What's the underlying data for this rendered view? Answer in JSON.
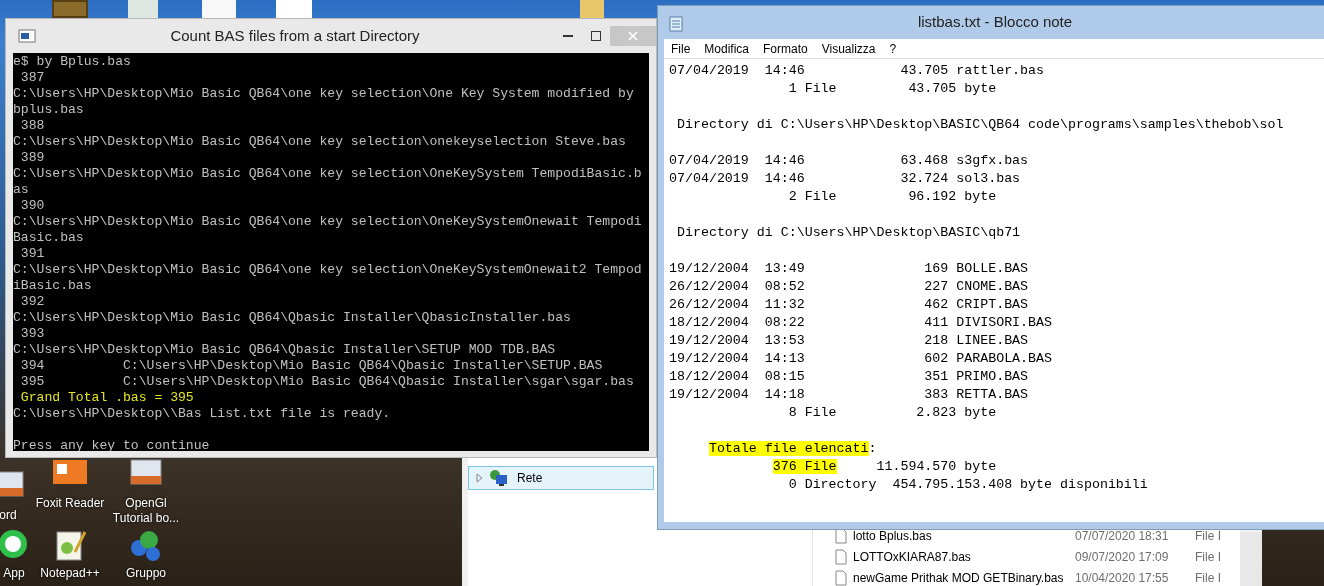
{
  "desktop_icons": [
    {
      "label": "ord",
      "kind": "doc"
    },
    {
      "label": "Foxit Reader",
      "kind": "pdf"
    },
    {
      "label": "OpenGl Tutorial bo...",
      "kind": "doc"
    },
    {
      "label": "App",
      "kind": "chat"
    },
    {
      "label": "Notepad++",
      "kind": "notepad"
    },
    {
      "label": "Gruppo",
      "kind": "group"
    }
  ],
  "console": {
    "title": "Count BAS files from a start Directory",
    "lines": [
      {
        "text": "e$ by Bplus.bas",
        "highlighted": false,
        "gap_before": false
      },
      {
        "text": " 387",
        "highlighted": false,
        "gap_before": false
      },
      {
        "text": "C:\\Users\\HP\\Desktop\\Mio Basic QB64\\one key selection\\One Key System modified by",
        "highlighted": false,
        "gap_before": false
      },
      {
        "text": "bplus.bas",
        "highlighted": false,
        "gap_before": false
      },
      {
        "text": " 388",
        "highlighted": false,
        "gap_before": false
      },
      {
        "text": "C:\\Users\\HP\\Desktop\\Mio Basic QB64\\one key selection\\onekeyselection Steve.bas",
        "highlighted": false,
        "gap_before": false
      },
      {
        "text": " 389",
        "highlighted": false,
        "gap_before": false
      },
      {
        "text": "C:\\Users\\HP\\Desktop\\Mio Basic QB64\\one key selection\\OneKeySystem TempodiBasic.b",
        "highlighted": false,
        "gap_before": false
      },
      {
        "text": "as",
        "highlighted": false,
        "gap_before": false
      },
      {
        "text": " 390",
        "highlighted": false,
        "gap_before": false
      },
      {
        "text": "C:\\Users\\HP\\Desktop\\Mio Basic QB64\\one key selection\\OneKeySystemOnewait Tempodi",
        "highlighted": false,
        "gap_before": false
      },
      {
        "text": "Basic.bas",
        "highlighted": false,
        "gap_before": false
      },
      {
        "text": " 391",
        "highlighted": false,
        "gap_before": false
      },
      {
        "text": "C:\\Users\\HP\\Desktop\\Mio Basic QB64\\one key selection\\OneKeySystemOnewait2 Tempod",
        "highlighted": false,
        "gap_before": false
      },
      {
        "text": "iBasic.bas",
        "highlighted": false,
        "gap_before": false
      },
      {
        "text": " 392",
        "highlighted": false,
        "gap_before": false
      },
      {
        "text": "C:\\Users\\HP\\Desktop\\Mio Basic QB64\\Qbasic Installer\\QbasicInstaller.bas",
        "highlighted": false,
        "gap_before": false
      },
      {
        "text": " 393",
        "highlighted": false,
        "gap_before": false
      },
      {
        "text": "C:\\Users\\HP\\Desktop\\Mio Basic QB64\\Qbasic Installer\\SETUP MOD TDB.BAS",
        "highlighted": false,
        "gap_before": false
      },
      {
        "text": " 394          C:\\Users\\HP\\Desktop\\Mio Basic QB64\\Qbasic Installer\\SETUP.BAS",
        "highlighted": false,
        "gap_before": false
      },
      {
        "text": " 395          C:\\Users\\HP\\Desktop\\Mio Basic QB64\\Qbasic Installer\\sgar\\sgar.bas",
        "highlighted": false,
        "gap_before": false
      },
      {
        "text": " Grand Total .bas = 395",
        "highlighted": true,
        "gap_before": false
      },
      {
        "text": "C:\\Users\\HP\\Desktop\\\\Bas List.txt file is ready.",
        "highlighted": false,
        "gap_before": false
      },
      {
        "text": "Press any key to continue",
        "highlighted": false,
        "gap_before": true
      }
    ]
  },
  "explorer": {
    "nav_items": [
      {
        "label": "Rete",
        "expanded": false,
        "selected": true
      }
    ],
    "files": [
      {
        "name": "lotto Bplus.bas",
        "modified": "07/07/2020 18:31",
        "type": "File I"
      },
      {
        "name": "LOTTOxKIARA87.bas",
        "modified": "09/07/2020 17:09",
        "type": "File I"
      },
      {
        "name": "newGame Prithak MOD GETBinary.bas",
        "modified": "10/04/2020 17:55",
        "type": "File I"
      }
    ]
  },
  "notepad": {
    "title": "listbas.txt - Blocco note",
    "menu": [
      "File",
      "Modifica",
      "Formato",
      "Visualizza",
      "?"
    ],
    "lines": [
      {
        "gap_before": false,
        "segments": [
          {
            "text": "07/04/2019  14:46            43.705 rattler.bas",
            "highlighted": false
          }
        ]
      },
      {
        "gap_before": false,
        "segments": [
          {
            "text": "               1 File         43.705 byte",
            "highlighted": false
          }
        ]
      },
      {
        "gap_before": true,
        "segments": [
          {
            "text": " Directory di C:\\Users\\HP\\Desktop\\BASIC\\QB64 code\\programs\\samples\\thebob\\sol",
            "highlighted": false
          }
        ]
      },
      {
        "gap_before": true,
        "segments": [
          {
            "text": "07/04/2019  14:46            63.468 s3gfx.bas",
            "highlighted": false
          }
        ]
      },
      {
        "gap_before": false,
        "segments": [
          {
            "text": "07/04/2019  14:46            32.724 sol3.bas",
            "highlighted": false
          }
        ]
      },
      {
        "gap_before": false,
        "segments": [
          {
            "text": "               2 File         96.192 byte",
            "highlighted": false
          }
        ]
      },
      {
        "gap_before": true,
        "segments": [
          {
            "text": " Directory di C:\\Users\\HP\\Desktop\\BASIC\\qb71",
            "highlighted": false
          }
        ]
      },
      {
        "gap_before": true,
        "segments": [
          {
            "text": "19/12/2004  13:49               169 BOLLE.BAS",
            "highlighted": false
          }
        ]
      },
      {
        "gap_before": false,
        "segments": [
          {
            "text": "26/12/2004  08:52               227 CNOME.BAS",
            "highlighted": false
          }
        ]
      },
      {
        "gap_before": false,
        "segments": [
          {
            "text": "26/12/2004  11:32               462 CRIPT.BAS",
            "highlighted": false
          }
        ]
      },
      {
        "gap_before": false,
        "segments": [
          {
            "text": "18/12/2004  08:22               411 DIVISORI.BAS",
            "highlighted": false
          }
        ]
      },
      {
        "gap_before": false,
        "segments": [
          {
            "text": "19/12/2004  13:53               218 LINEE.BAS",
            "highlighted": false
          }
        ]
      },
      {
        "gap_before": false,
        "segments": [
          {
            "text": "19/12/2004  14:13               602 PARABOLA.BAS",
            "highlighted": false
          }
        ]
      },
      {
        "gap_before": false,
        "segments": [
          {
            "text": "18/12/2004  08:15               351 PRIMO.BAS",
            "highlighted": false
          }
        ]
      },
      {
        "gap_before": false,
        "segments": [
          {
            "text": "19/12/2004  14:18               383 RETTA.BAS",
            "highlighted": false
          }
        ]
      },
      {
        "gap_before": false,
        "segments": [
          {
            "text": "               8 File          2.823 byte",
            "highlighted": false
          }
        ]
      },
      {
        "gap_before": true,
        "segments": [
          {
            "text": "     Totale file elencati",
            "highlighted": true
          },
          {
            "text": ":",
            "highlighted": false
          }
        ]
      },
      {
        "gap_before": false,
        "segments": [
          {
            "text": "             376 File",
            "highlighted": true
          },
          {
            "text": "     11.594.570 byte",
            "highlighted": false
          }
        ]
      },
      {
        "gap_before": false,
        "segments": [
          {
            "text": "               0 Directory  454.795.153.408 byte disponibili",
            "highlighted": false
          }
        ]
      }
    ]
  }
}
